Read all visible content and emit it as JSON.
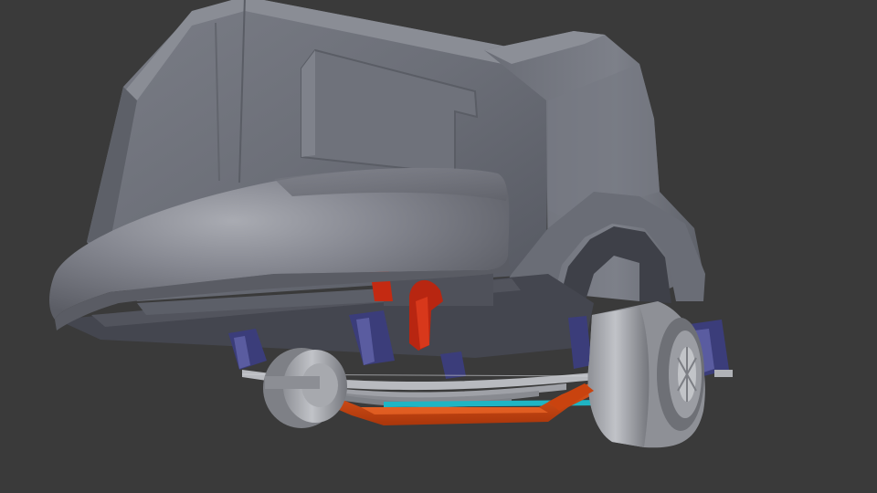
{
  "viewport": {
    "background": "#3a3a3a"
  },
  "palette": {
    "body_light": "#8e9098",
    "body_mid": "#70737c",
    "body_dark": "#55575f",
    "body_edge": "#4a4c53",
    "underside": "#4a4c56",
    "bracket": "#3b3d7a",
    "bracket_light": "#5a5ca0",
    "steel": "#b8babf",
    "steel_dark": "#7d8086",
    "axle_orange": "#c9430f",
    "axle_orange_light": "#e0551a",
    "cyan_line": "#1fb5c4",
    "red_part": "#c42a12",
    "tire": "#a2a4aa",
    "tire_dark": "#6e7076"
  },
  "parts": [
    "vehicle-body",
    "roof-panel",
    "front-bumper",
    "fender-arch",
    "rear-wheel",
    "front-wheel",
    "leaf-spring",
    "axle-beam",
    "steering-arm",
    "chassis-bracket"
  ]
}
